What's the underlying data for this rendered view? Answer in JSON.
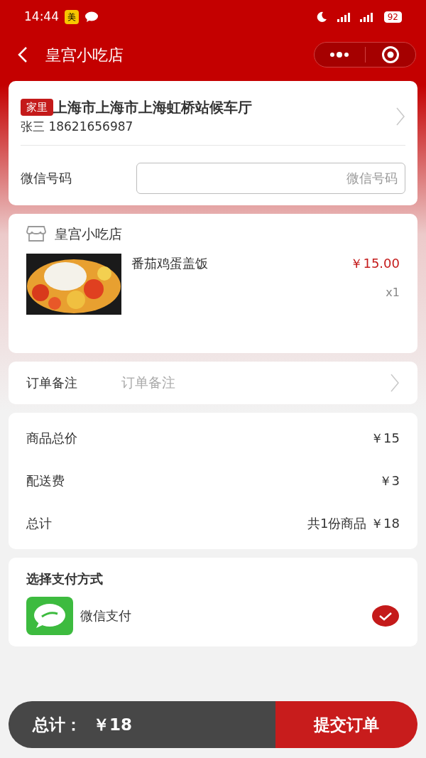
{
  "status_bar": {
    "time": "14:44",
    "app_badge": "美",
    "battery": "92"
  },
  "nav": {
    "title": "皇宫小吃店"
  },
  "address": {
    "tag": "家里",
    "line": "上海市上海市上海虹桥站候车厅",
    "contact": "张三 18621656987"
  },
  "wechat_field": {
    "label": "微信号码",
    "placeholder": "微信号码"
  },
  "shop": {
    "name": "皇宫小吃店",
    "items": [
      {
        "name": "番茄鸡蛋盖饭",
        "price": "￥15.00",
        "qty": "x1"
      }
    ]
  },
  "remark": {
    "label": "订单备注",
    "placeholder": "订单备注"
  },
  "summary": [
    {
      "label": "商品总价",
      "value": "￥15"
    },
    {
      "label": "配送费",
      "value": "￥3"
    },
    {
      "label": "总计",
      "value": "共1份商品 ￥18"
    }
  ],
  "payment": {
    "title": "选择支付方式",
    "options": [
      {
        "name": "微信支付",
        "selected": true
      }
    ]
  },
  "footer": {
    "total": "总计：  ￥18",
    "submit": "提交订单"
  }
}
